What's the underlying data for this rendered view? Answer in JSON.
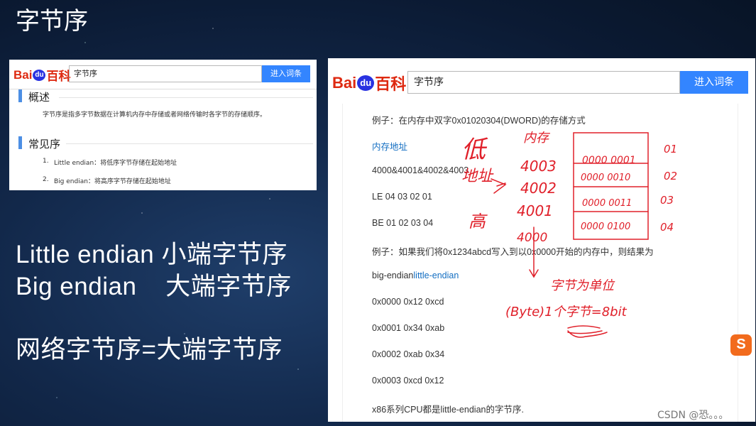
{
  "slide": {
    "title": "字节序",
    "line1": "Little endian 小端字节序",
    "line2": "Big endian    大端字节序",
    "line3": "网络字节序=大端字节序"
  },
  "brand": {
    "bai": "Bai",
    "du": "du",
    "baike": "百科",
    "accent": "#3385ff",
    "logo_red": "#de2910"
  },
  "screenshot_small": {
    "search_value": "字节序",
    "button": "进入词条",
    "section1_title": "概述",
    "section1_text": "字节序是指多字节数据在计算机内存中存储或者网络传输时各字节的存储顺序。",
    "section2_title": "常见序",
    "item1_num": "1.",
    "item1_text": "Little endian：将低序字节存储在起始地址",
    "item2_num": "2.",
    "item2_text": "Big endian：将高序字节存储在起始地址"
  },
  "screenshot_large": {
    "search_value": "字节序",
    "button": "进入词条",
    "rows": {
      "example1": "例子：在内存中双字0x01020304(DWORD)的存储方式",
      "mem_addr": "内存地址",
      "addrs": "4000&4001&4002&4003",
      "le": "LE 04 03 02 01",
      "be": "BE 01 02 03 04",
      "example2": "例子：如果我们将0x1234abcd写入到以0x0000开始的内存中，则结果为",
      "big": "big-endian",
      "little": "little-endian",
      "r0": "0x0000 0x12 0xcd",
      "r1": "0x0001 0x34 0xab",
      "r2": "0x0002 0xab 0x34",
      "r3": "0x0003 0xcd 0x12",
      "x86": "x86系列CPU都是little-endian的字节序."
    }
  },
  "annotations": {
    "low": "低",
    "addr": "地址",
    "high": "高",
    "mem": "内存",
    "a4003": "4003",
    "a4002": "4002",
    "a4001": "4001",
    "a4000": "4000",
    "b1": "0000 0001",
    "b2": "0000 0010",
    "b3": "0000 0011",
    "b4": "0000 0100",
    "n01": "01",
    "n02": "02",
    "n03": "03",
    "n04": "04",
    "unit": "字节为单位",
    "byte": "(Byte)1个字节=8bit",
    "ink_color": "#e0202a"
  },
  "sogou_icon": "S",
  "watermark": "CSDN @恐。。。"
}
